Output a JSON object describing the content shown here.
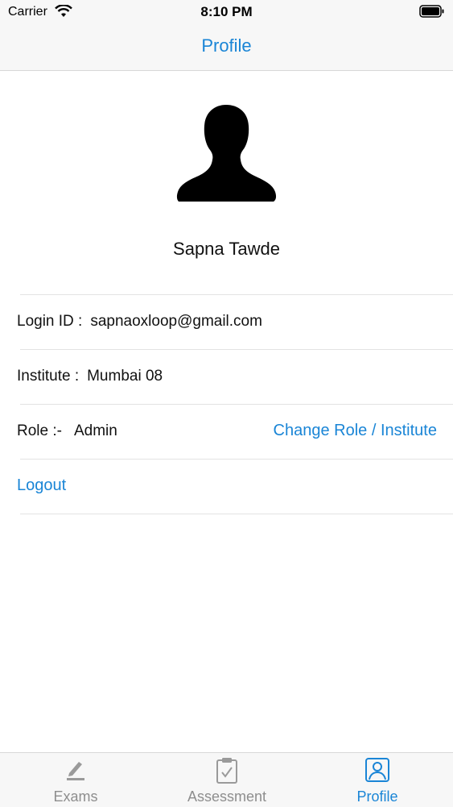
{
  "status_bar": {
    "carrier": "Carrier",
    "time": "8:10 PM"
  },
  "nav": {
    "title": "Profile"
  },
  "profile": {
    "name": "Sapna Tawde",
    "login_label": "Login ID :",
    "login_value": "sapnaoxloop@gmail.com",
    "institute_label": "Institute :",
    "institute_value": "Mumbai 08",
    "role_label": "Role :-",
    "role_value": "Admin",
    "change_role_label": "Change Role / Institute",
    "logout_label": "Logout"
  },
  "tabs": [
    {
      "label": "Exams",
      "icon": "pencil-icon",
      "active": false
    },
    {
      "label": "Assessment",
      "icon": "clipboard-check-icon",
      "active": false
    },
    {
      "label": "Profile",
      "icon": "person-icon",
      "active": true
    }
  ],
  "colors": {
    "accent": "#1a85d6",
    "inactive": "#8e8e8e",
    "bar_bg": "#f7f7f7"
  }
}
